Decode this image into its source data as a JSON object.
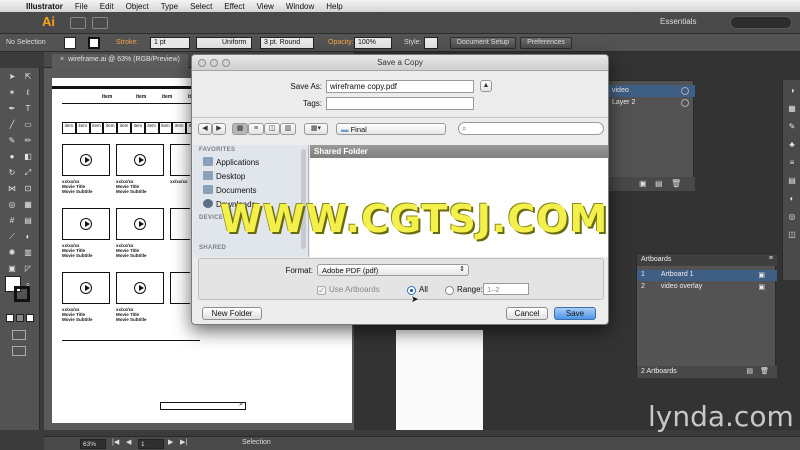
{
  "menubar": {
    "app_name": "Illustrator",
    "items": [
      "File",
      "Edit",
      "Object",
      "Type",
      "Select",
      "Effect",
      "View",
      "Window",
      "Help"
    ]
  },
  "appbar": {
    "logo": "Ai",
    "workspace": "Essentials"
  },
  "controlbar": {
    "selection": "No Selection",
    "stroke_label": "Stroke:",
    "stroke_value": "1 pt",
    "profile": "Uniform",
    "brush": "3 pt. Round",
    "opacity_label": "Opacity:",
    "opacity_value": "100%",
    "style_label": "Style:",
    "doc_setup": "Document Setup",
    "preferences": "Preferences"
  },
  "document_tab": "wireframe.ai @ 63% (RGB/Preview)",
  "wireframe": {
    "nav_items": [
      "item",
      "item",
      "item",
      "item"
    ],
    "table_cells": [
      "item",
      "item",
      "item",
      "item",
      "item",
      "item",
      "item",
      "item",
      "item",
      "item"
    ],
    "thumb_caption": [
      "xx/xx/xx",
      "Movie Title",
      "Movie Subtitle"
    ]
  },
  "dialog": {
    "title": "Save a Copy",
    "save_as_label": "Save As:",
    "save_as_value": "wireframe copy.pdf",
    "tags_label": "Tags:",
    "tags_value": "",
    "location": "Final",
    "sidebar_heading_favorites": "FAVORITES",
    "sidebar_items": [
      "Applications",
      "Desktop",
      "Documents",
      "Downloads"
    ],
    "sidebar_heading_devices": "DEVICES",
    "sidebar_heading_shared": "SHARED",
    "column_header": "Shared Folder",
    "format_label": "Format:",
    "format_value": "Adobe PDF (pdf)",
    "use_artboards": "Use Artboards",
    "all_label": "All",
    "range_label": "Range:",
    "range_value": "1–2",
    "new_folder": "New Folder",
    "cancel": "Cancel",
    "save": "Save"
  },
  "layers_panel": {
    "rows": [
      "video",
      "Layer 2"
    ]
  },
  "artboards_panel": {
    "title": "Artboards",
    "rows": [
      {
        "num": "1",
        "name": "Artboard 1"
      },
      {
        "num": "2",
        "name": "video overlay"
      }
    ],
    "footer": "2 Artboards"
  },
  "statusbar": {
    "zoom": "63%",
    "page": "1",
    "tool": "Selection"
  },
  "watermarks": {
    "main": "WWW.CGTSJ.COM",
    "lynda": "lynda.com"
  },
  "colors": {
    "ai_orange": "#f7a21b",
    "selection_blue": "#3e5e83",
    "save_button_blue": "#4c95e7",
    "watermark_yellow": "#f3f04b"
  }
}
